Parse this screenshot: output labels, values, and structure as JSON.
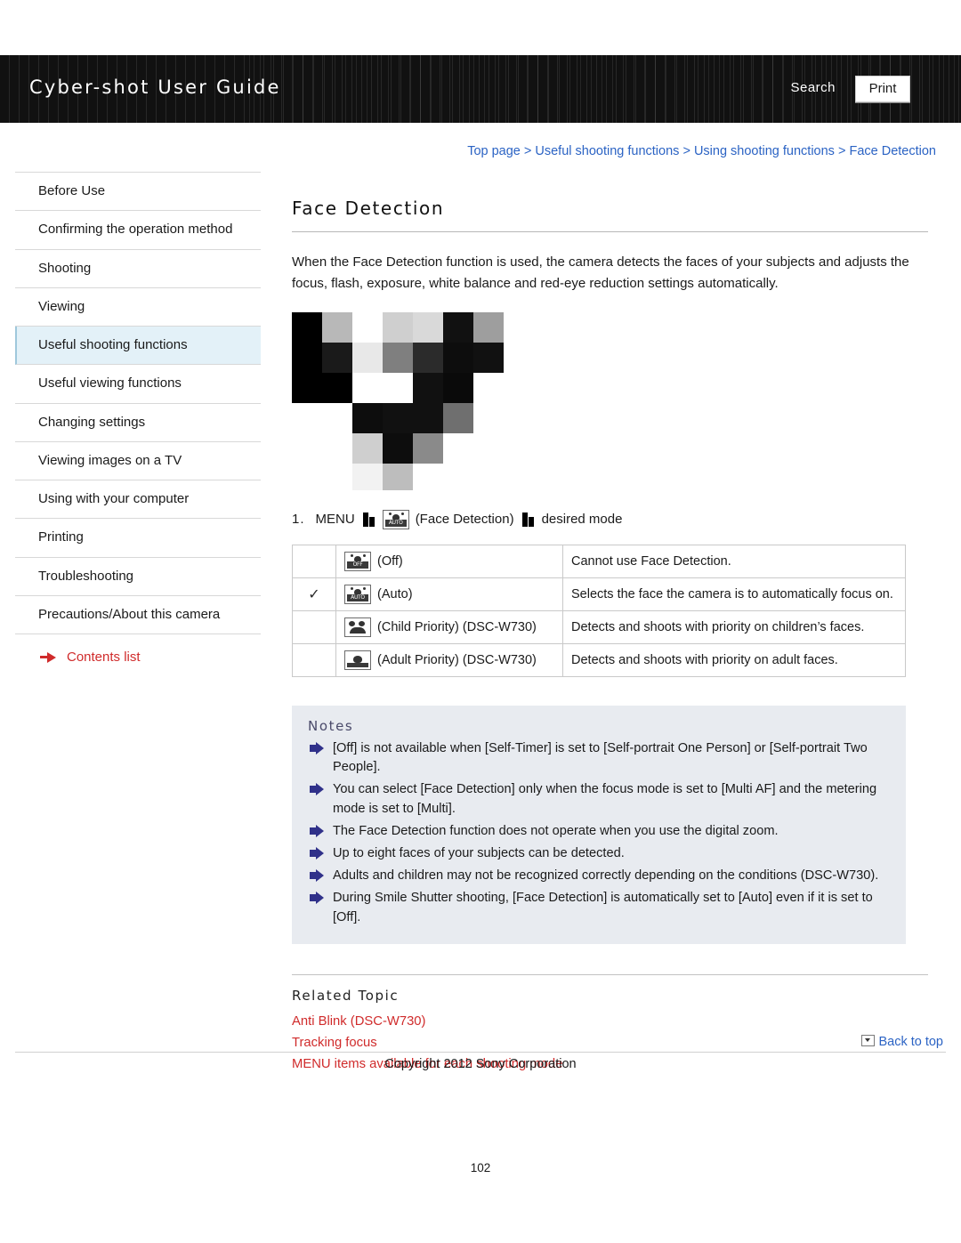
{
  "header": {
    "title": "Cyber-shot User Guide",
    "search_label": "Search",
    "print_label": "Print"
  },
  "breadcrumb": {
    "items": [
      "Top page",
      "Useful shooting functions",
      "Using shooting functions",
      "Face Detection"
    ],
    "separator": ">"
  },
  "sidebar": {
    "items": [
      {
        "label": "Before Use"
      },
      {
        "label": "Confirming the operation method"
      },
      {
        "label": "Shooting"
      },
      {
        "label": "Viewing"
      },
      {
        "label": "Useful shooting functions"
      },
      {
        "label": "Useful viewing functions"
      },
      {
        "label": "Changing settings"
      },
      {
        "label": "Viewing images on a TV"
      },
      {
        "label": "Using with your computer"
      },
      {
        "label": "Printing"
      },
      {
        "label": "Troubleshooting"
      },
      {
        "label": "Precautions/About this camera"
      }
    ],
    "contents_list_label": "Contents list"
  },
  "main": {
    "title": "Face Detection",
    "intro": "When the Face Detection function is used, the camera detects the faces of your subjects and adjusts the focus, flash, exposure, white balance and red-eye reduction settings automatically.",
    "step": {
      "number": "1.",
      "menu_label": "MENU",
      "mid_label": "(Face Detection)",
      "end_label": "desired mode"
    },
    "table": {
      "rows": [
        {
          "check": "",
          "icon": "face-off-icon",
          "icon_label": "(Off)",
          "description": "Cannot use Face Detection."
        },
        {
          "check": "✓",
          "icon": "face-auto-icon",
          "icon_label": "(Auto)",
          "description": "Selects the face the camera is to automatically focus on."
        },
        {
          "check": "",
          "icon": "child-priority-icon",
          "icon_label": "(Child Priority) (DSC-W730)",
          "description": "Detects and shoots with priority on children’s faces."
        },
        {
          "check": "",
          "icon": "adult-priority-icon",
          "icon_label": "(Adult Priority) (DSC-W730)",
          "description": "Detects and shoots with priority on adult faces."
        }
      ]
    },
    "notes": {
      "title": "Notes",
      "items": [
        "[Off] is not available when [Self-Timer] is set to [Self-portrait One Person] or [Self-portrait Two People].",
        "You can select [Face Detection] only when the focus mode is set to [Multi AF] and the metering mode is set to [Multi].",
        "The Face Detection function does not operate when you use the digital zoom.",
        "Up to eight faces of your subjects can be detected.",
        "Adults and children may not be recognized correctly depending on the conditions (DSC-W730).",
        "During Smile Shutter shooting, [Face Detection] is automatically set to [Auto] even if it is set to [Off]."
      ]
    },
    "related": {
      "title": "Related Topic",
      "links": [
        "Anti Blink (DSC-W730)",
        "Tracking focus",
        "MENU items available for each shooting mode"
      ]
    }
  },
  "footer": {
    "back_to_top": "Back to top",
    "copyright": "Copyright 2012 Sony Corporation",
    "page_number": "102"
  }
}
